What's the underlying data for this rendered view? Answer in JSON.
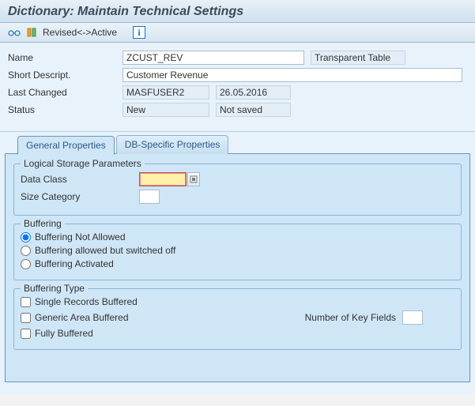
{
  "header": {
    "title": "Dictionary: Maintain Technical Settings"
  },
  "toolbar": {
    "revised_label": "Revised<->Active"
  },
  "form": {
    "name_label": "Name",
    "name_value": "ZCUST_REV",
    "type_value": "Transparent Table",
    "desc_label": "Short Descript.",
    "desc_value": "Customer Revenue",
    "changed_label": "Last Changed",
    "changed_user": "MASFUSER2",
    "changed_date": "26.05.2016",
    "status_label": "Status",
    "status_value": "New",
    "save_status": "Not saved"
  },
  "tabs": {
    "general": "General Properties",
    "dbspec": "DB-Specific Properties"
  },
  "storage": {
    "title": "Logical Storage Parameters",
    "data_class": "Data Class",
    "size_cat": "Size Category"
  },
  "buffering": {
    "title": "Buffering",
    "not_allowed": "Buffering Not Allowed",
    "switched_off": "Buffering allowed but switched off",
    "activated": "Buffering Activated"
  },
  "buffering_type": {
    "title": "Buffering Type",
    "single": "Single Records Buffered",
    "generic": "Generic Area Buffered",
    "fully": "Fully Buffered",
    "keyfields": "Number of Key Fields"
  }
}
